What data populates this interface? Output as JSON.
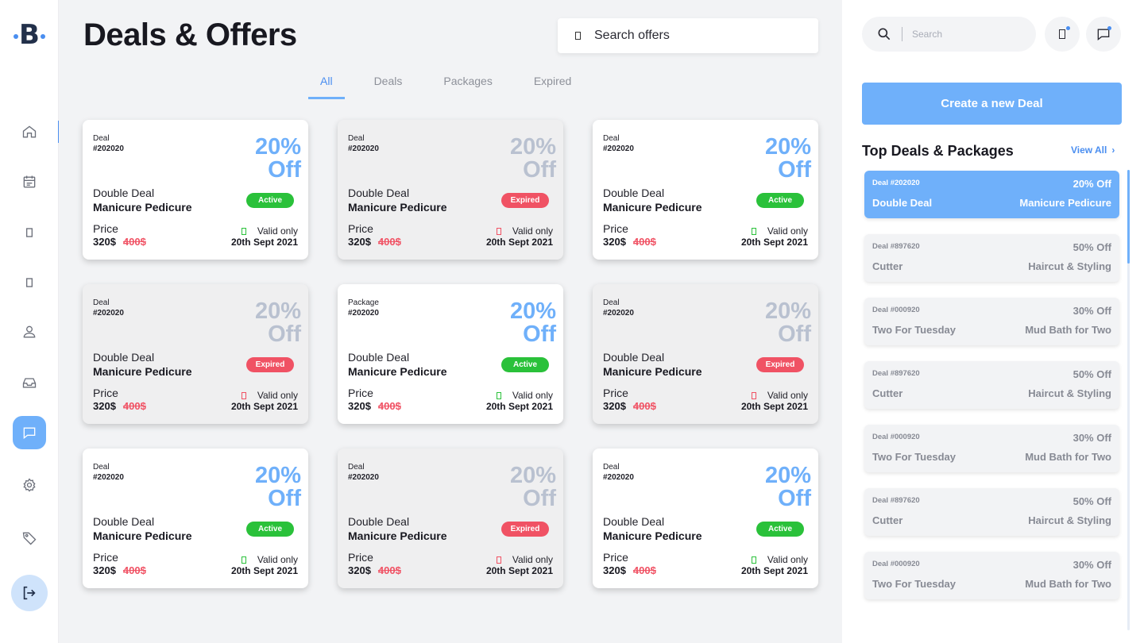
{
  "brand": {
    "logo": "B"
  },
  "page": {
    "title": "Deals & Offers",
    "search_placeholder": "Search offers"
  },
  "tabs": [
    {
      "label": "All",
      "active": true
    },
    {
      "label": "Deals",
      "active": false
    },
    {
      "label": "Packages",
      "active": false
    },
    {
      "label": "Expired",
      "active": false
    }
  ],
  "nav": [
    {
      "icon": "home-icon"
    },
    {
      "icon": "calendar-icon"
    },
    {
      "icon": "phone-icon"
    },
    {
      "icon": "phone-icon"
    },
    {
      "icon": "user-icon"
    },
    {
      "icon": "inbox-icon"
    },
    {
      "icon": "chat-icon",
      "active": true
    },
    {
      "icon": "settings-icon"
    },
    {
      "icon": "tag-icon"
    }
  ],
  "cards": [
    {
      "type": "Deal",
      "code": "#202020",
      "pct": "20%",
      "off": "Off",
      "name1": "Double Deal",
      "name2": "Manicure Pedicure",
      "status": "Active",
      "price_label": "Price",
      "price": "320$",
      "old_price": "400$",
      "valid": "Valid only",
      "date": "20th  Sept 2021"
    },
    {
      "type": "Deal",
      "code": "#202020",
      "pct": "20%",
      "off": "Off",
      "name1": "Double Deal",
      "name2": "Manicure Pedicure",
      "status": "Expired",
      "price_label": "Price",
      "price": "320$",
      "old_price": "400$",
      "valid": "Valid only",
      "date": "20th  Sept 2021"
    },
    {
      "type": "Deal",
      "code": "#202020",
      "pct": "20%",
      "off": "Off",
      "name1": "Double Deal",
      "name2": "Manicure Pedicure",
      "status": "Active",
      "price_label": "Price",
      "price": "320$",
      "old_price": "400$",
      "valid": "Valid only",
      "date": "20th  Sept 2021"
    },
    {
      "type": "Deal",
      "code": "#202020",
      "pct": "20%",
      "off": "Off",
      "name1": "Double Deal",
      "name2": "Manicure Pedicure",
      "status": "Expired",
      "price_label": "Price",
      "price": "320$",
      "old_price": "400$",
      "valid": "Valid only",
      "date": "20th  Sept 2021"
    },
    {
      "type": "Package",
      "code": "#202020",
      "pct": "20%",
      "off": "Off",
      "name1": "Double Deal",
      "name2": "Manicure Pedicure",
      "status": "Active",
      "price_label": "Price",
      "price": "320$",
      "old_price": "400$",
      "valid": "Valid only",
      "date": "20th  Sept 2021"
    },
    {
      "type": "Deal",
      "code": "#202020",
      "pct": "20%",
      "off": "Off",
      "name1": "Double Deal",
      "name2": "Manicure Pedicure",
      "status": "Expired",
      "price_label": "Price",
      "price": "320$",
      "old_price": "400$",
      "valid": "Valid only",
      "date": "20th  Sept 2021"
    },
    {
      "type": "Deal",
      "code": "#202020",
      "pct": "20%",
      "off": "Off",
      "name1": "Double Deal",
      "name2": "Manicure Pedicure",
      "status": "Active",
      "price_label": "Price",
      "price": "320$",
      "old_price": "400$",
      "valid": "Valid only",
      "date": "20th  Sept 2021"
    },
    {
      "type": "Deal",
      "code": "#202020",
      "pct": "20%",
      "off": "Off",
      "name1": "Double Deal",
      "name2": "Manicure Pedicure",
      "status": "Expired",
      "price_label": "Price",
      "price": "320$",
      "old_price": "400$",
      "valid": "Valid only",
      "date": "20th  Sept 2021"
    },
    {
      "type": "Deal",
      "code": "#202020",
      "pct": "20%",
      "off": "Off",
      "name1": "Double Deal",
      "name2": "Manicure Pedicure",
      "status": "Active",
      "price_label": "Price",
      "price": "320$",
      "old_price": "400$",
      "valid": "Valid only",
      "date": "20th  Sept 2021"
    }
  ],
  "right": {
    "search_placeholder": "Search",
    "create_label": "Create a new Deal",
    "top_title": "Top Deals & Packages",
    "view_all": "View All",
    "items": [
      {
        "id": "Deal #202020",
        "off": "20% Off",
        "name": "Double Deal",
        "desc": "Manicure Pedicure",
        "active": true
      },
      {
        "id": "Deal #897620",
        "off": "50% Off",
        "name": "Cutter",
        "desc": "Haircut & Styling"
      },
      {
        "id": "Deal #000920",
        "off": "30% Off",
        "name": "Two For Tuesday",
        "desc": "Mud Bath for Two"
      },
      {
        "id": "Deal #897620",
        "off": "50% Off",
        "name": "Cutter",
        "desc": "Haircut & Styling"
      },
      {
        "id": "Deal #000920",
        "off": "30% Off",
        "name": "Two For Tuesday",
        "desc": "Mud Bath for Two"
      },
      {
        "id": "Deal #897620",
        "off": "50% Off",
        "name": "Cutter",
        "desc": "Haircut & Styling"
      },
      {
        "id": "Deal #000920",
        "off": "30% Off",
        "name": "Two For Tuesday",
        "desc": "Mud Bath for Two"
      }
    ]
  },
  "colors": {
    "accent": "#6fb0fa",
    "active": "#2ac13a",
    "expired": "#f05264"
  }
}
